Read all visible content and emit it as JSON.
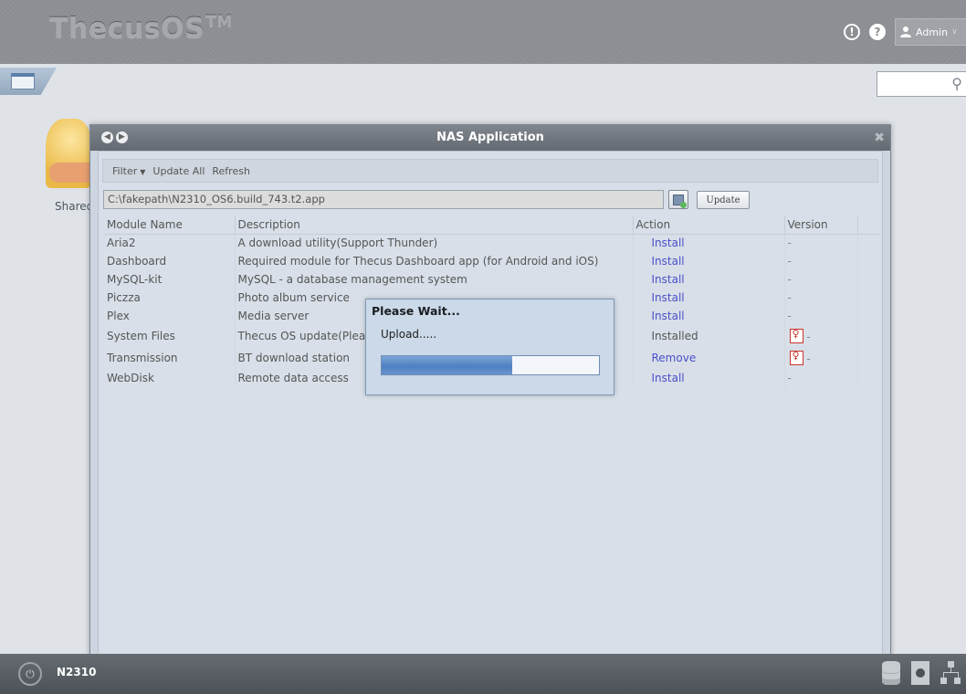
{
  "topbar": {
    "brand": "ThecusOS",
    "brand_mark": "TM",
    "user": "Admin",
    "notice_glyph": "!",
    "help_glyph": "?"
  },
  "desktop": {
    "shared_label": "Shared"
  },
  "window": {
    "title": "NAS Application",
    "toolbar": {
      "filter": "Filter",
      "update_all": "Update All",
      "refresh": "Refresh"
    },
    "file_path": "C:\\fakepath\\N2310_OS6.build_743.t2.app",
    "update_button": "Update",
    "columns": {
      "module_name": "Module Name",
      "description": "Description",
      "action": "Action",
      "version": "Version"
    },
    "rows": [
      {
        "name": "Aria2",
        "description": "A download utility(Support Thunder)",
        "action": "Install",
        "version": "-"
      },
      {
        "name": "Dashboard",
        "description": "Required module for Thecus Dashboard app (for Android and iOS)",
        "action": "Install",
        "version": "-"
      },
      {
        "name": "MySQL-kit",
        "description": "MySQL - a database management system",
        "action": "Install",
        "version": "-"
      },
      {
        "name": "Piczza",
        "description": "Photo album service",
        "action": "Install",
        "version": "-"
      },
      {
        "name": "Plex",
        "description": "Media server",
        "action": "Install",
        "version": "-"
      },
      {
        "name": "System Files",
        "description": "Thecus OS update(Please update and reboot first!)",
        "action": "Installed",
        "version": "-"
      },
      {
        "name": "Transmission",
        "description": "BT download station",
        "action": "Remove",
        "version": "-"
      },
      {
        "name": "WebDisk",
        "description": "Remote data access",
        "action": "Install",
        "version": "-"
      }
    ]
  },
  "dialog": {
    "title": "Please Wait...",
    "message": "Upload.....",
    "progress": 0.6
  },
  "taskbar": {
    "device": "N2310"
  },
  "colors": {
    "action_link": "#4b50c8",
    "titlebar": "#6b7179",
    "progress": "#4e7fc2"
  }
}
